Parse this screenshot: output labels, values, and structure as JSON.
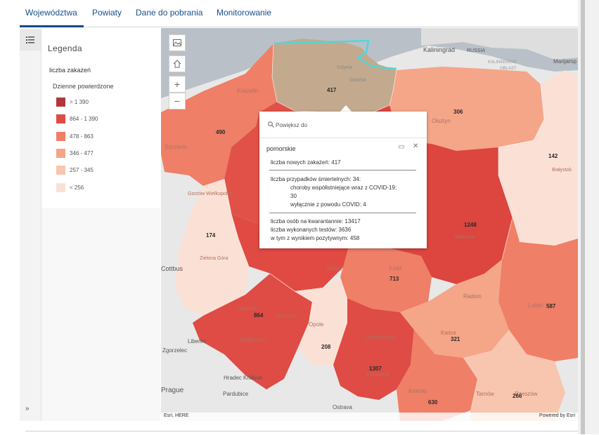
{
  "tabs": [
    "Województwa",
    "Powiaty",
    "Dane do pobrania",
    "Monitorowanie"
  ],
  "legend": {
    "title": "Legenda",
    "layer": "liczba zakażeń",
    "field": "Dzienne powierdzone",
    "classes": [
      {
        "label": "> 1 390",
        "color": "#b0383b"
      },
      {
        "label": "864 - 1 390",
        "color": "#de4c45"
      },
      {
        "label": "478 - 863",
        "color": "#ef7f67"
      },
      {
        "label": "346 - 477",
        "color": "#f5a588"
      },
      {
        "label": "257 - 345",
        "color": "#f8c5ae"
      },
      {
        "label": "< 256",
        "color": "#fbe1d5"
      }
    ]
  },
  "map": {
    "attribution_left": "Esri, HERE",
    "attribution_right": "Powered by Esri",
    "values": [
      "417",
      "306",
      "490",
      "142",
      "174",
      "1248",
      "713",
      "587",
      "864",
      "321",
      "208",
      "1307",
      "630",
      "266"
    ],
    "places": [
      "Kaliningrad",
      "RUSSIA",
      "KALININGRAD",
      "OBLAST",
      "Marijamp",
      "Gdynia",
      "Gdańsk",
      "Koszalin",
      "Olsztyn",
      "Szczecin",
      "Białystok",
      "Gorzów Wielkopolski",
      "Warsaw",
      "Zielona Góra",
      "Kalisz",
      "Łódź",
      "Radom",
      "Lublin",
      "Legnica",
      "Wrocław",
      "Wałbrzych",
      "Liberec",
      "Opole",
      "Kielce",
      "Częstochowa",
      "Katowice",
      "Tarnów",
      "Hradec Králové",
      "Pardubice",
      "Ostrava",
      "Kraków",
      "Rzeszów",
      "Prague",
      "Cottbus",
      "Zgorzelec"
    ]
  },
  "popup": {
    "zoom_label": "Powiększ do",
    "title": "pomorskie",
    "new_cases": "liczba nowych zakażeń: 417",
    "deaths": "liczba przypadków śmiertelnych: 34:",
    "comorbid": "choroby współistniejące wraz z COVID-19:",
    "comorbid_value": "30",
    "covid_only": "wyłącznie z powodu COVID: 4",
    "quarantine": "liczba osób na kwarantannie: 13417",
    "tests": "liczba wykonanych testów: 3636",
    "positive": "w tym z wynikiem pozytywnym: 458"
  }
}
